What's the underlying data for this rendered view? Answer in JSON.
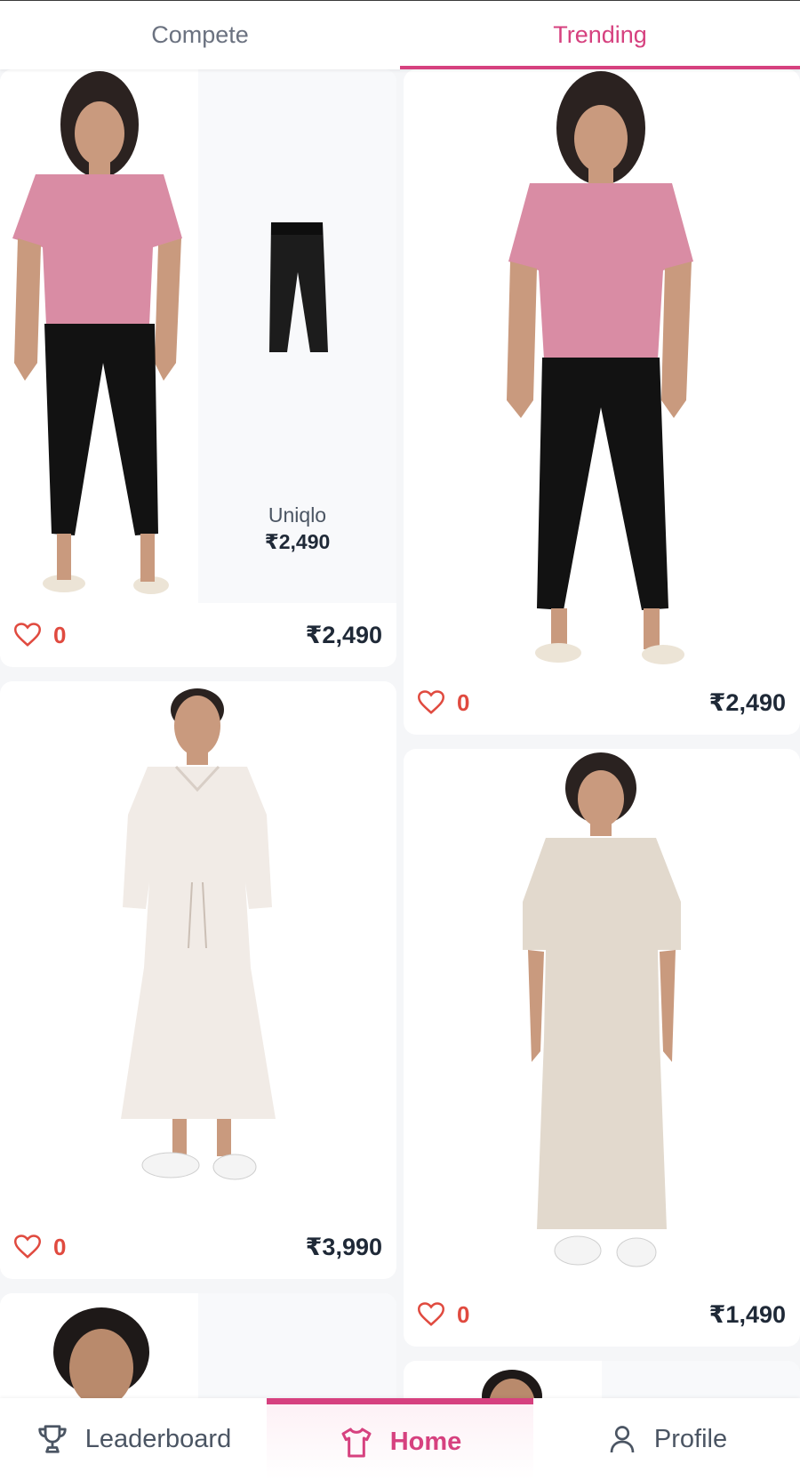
{
  "tabs": {
    "compete": "Compete",
    "trending": "Trending"
  },
  "cards": [
    {
      "likes": "0",
      "price": "₹2,490",
      "brand": "Uniqlo",
      "item_price": "₹2,490"
    },
    {
      "likes": "0",
      "price": "₹2,490"
    },
    {
      "likes": "0",
      "price": "₹3,990"
    },
    {
      "likes": "0",
      "price": "₹1,490"
    }
  ],
  "nav": {
    "leaderboard": "Leaderboard",
    "home": "Home",
    "profile": "Profile"
  },
  "colors": {
    "accent": "#d6417f",
    "like": "#e04a3f",
    "price": "#1f2937"
  },
  "icons": [
    "heart-icon",
    "trophy-icon",
    "tshirt-icon",
    "user-icon"
  ]
}
